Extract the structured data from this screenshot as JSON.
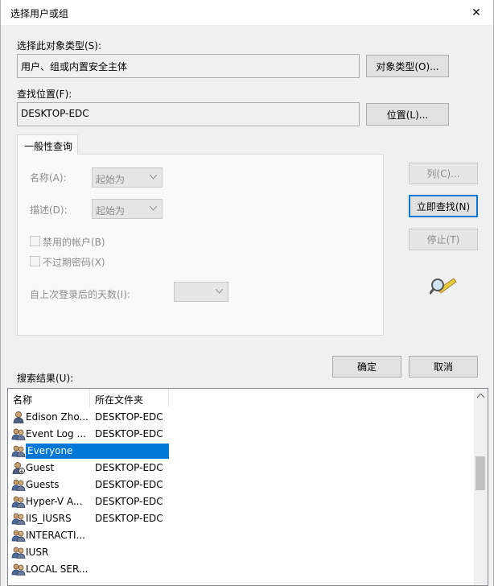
{
  "window": {
    "title": "选择用户或组",
    "close_glyph": "✕"
  },
  "object_type": {
    "label": "选择此对象类型(S):",
    "value": "用户、组或内置安全主体",
    "button": "对象类型(O)..."
  },
  "location": {
    "label": "查找位置(F):",
    "value": "DESKTOP-EDC",
    "button": "位置(L)..."
  },
  "query": {
    "tab": "一般性查询",
    "name_label": "名称(A):",
    "name_mode": "起始为",
    "desc_label": "描述(D):",
    "desc_mode": "起始为",
    "disabled_accounts": "禁用的帐户(B)",
    "non_expiring_pw": "不过期密码(X)",
    "days_label": "自上次登录后的天数(I):"
  },
  "side_buttons": {
    "columns": "列(C)...",
    "find_now": "立即查找(N)",
    "stop": "停止(T)"
  },
  "actions": {
    "ok": "确定",
    "cancel": "取消"
  },
  "results": {
    "label": "搜索结果(U):",
    "columns": [
      "名称",
      "所在文件夹"
    ],
    "rows": [
      {
        "name": "Edison Zho...",
        "folder": "DESKTOP-EDC",
        "icon": "user-icon"
      },
      {
        "name": "Event Log ...",
        "folder": "DESKTOP-EDC",
        "icon": "group-icon"
      },
      {
        "name": "Everyone",
        "folder": "",
        "icon": "group-icon",
        "selected": true
      },
      {
        "name": "Guest",
        "folder": "DESKTOP-EDC",
        "icon": "disabled-user-icon"
      },
      {
        "name": "Guests",
        "folder": "DESKTOP-EDC",
        "icon": "group-icon"
      },
      {
        "name": "Hyper-V A...",
        "folder": "DESKTOP-EDC",
        "icon": "group-icon"
      },
      {
        "name": "IIS_IUSRS",
        "folder": "DESKTOP-EDC",
        "icon": "group-icon"
      },
      {
        "name": "INTERACTI...",
        "folder": "",
        "icon": "group-icon"
      },
      {
        "name": "IUSR",
        "folder": "",
        "icon": "group-icon"
      },
      {
        "name": "LOCAL SER...",
        "folder": "",
        "icon": "group-icon"
      }
    ]
  },
  "colors": {
    "selection": "#0078d7",
    "focus_border": "#0078d7"
  }
}
